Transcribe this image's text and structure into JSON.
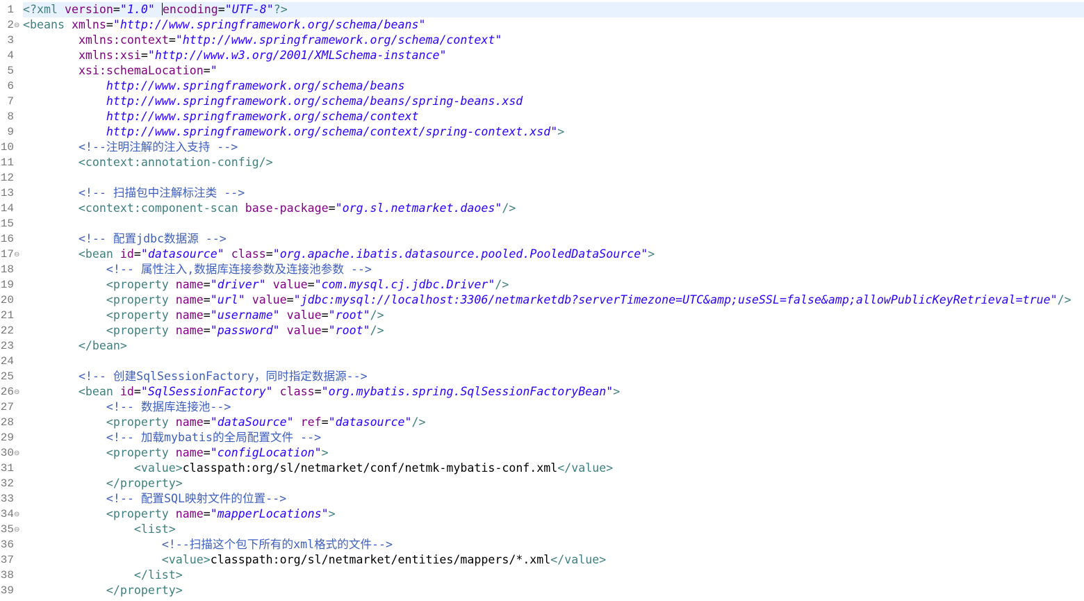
{
  "editor": {
    "file_type": "xml",
    "current_line": 1,
    "cursor": {
      "line": 1,
      "segment": 4,
      "offset": 1
    },
    "colors": {
      "tag": "#3f7f7f",
      "attr": "#7f007f",
      "value": "#2a00ff",
      "comment": "#3f5fbf",
      "text": "#000000",
      "line_number": "#787878",
      "current_line_bg": "#e8f2fe"
    },
    "lines": [
      {
        "num": "1",
        "fold": false,
        "segs": [
          {
            "t": "<?xml ",
            "k": "tag"
          },
          {
            "t": "version",
            "k": "attr"
          },
          {
            "t": "=",
            "k": "text"
          },
          {
            "t": "\"1.0\"",
            "k": "value"
          },
          {
            "t": " encoding",
            "k": "attr"
          },
          {
            "t": "=",
            "k": "text"
          },
          {
            "t": "\"UTF-8\"",
            "k": "value"
          },
          {
            "t": "?>",
            "k": "tag"
          }
        ]
      },
      {
        "num": "2",
        "fold": true,
        "segs": [
          {
            "t": "<beans ",
            "k": "tag"
          },
          {
            "t": "xmlns",
            "k": "attr"
          },
          {
            "t": "=",
            "k": "text"
          },
          {
            "t": "\"http://www.springframework.org/schema/beans\"",
            "k": "value"
          }
        ]
      },
      {
        "num": "3",
        "fold": false,
        "segs": [
          {
            "t": "        ",
            "k": "text"
          },
          {
            "t": "xmlns:context",
            "k": "attr"
          },
          {
            "t": "=",
            "k": "text"
          },
          {
            "t": "\"http://www.springframework.org/schema/context\"",
            "k": "value"
          }
        ]
      },
      {
        "num": "4",
        "fold": false,
        "segs": [
          {
            "t": "        ",
            "k": "text"
          },
          {
            "t": "xmlns:xsi",
            "k": "attr"
          },
          {
            "t": "=",
            "k": "text"
          },
          {
            "t": "\"http://www.w3.org/2001/XMLSchema-instance\"",
            "k": "value"
          }
        ]
      },
      {
        "num": "5",
        "fold": false,
        "segs": [
          {
            "t": "        ",
            "k": "text"
          },
          {
            "t": "xsi:schemaLocation",
            "k": "attr"
          },
          {
            "t": "=",
            "k": "text"
          },
          {
            "t": "\"",
            "k": "value"
          }
        ]
      },
      {
        "num": "6",
        "fold": false,
        "segs": [
          {
            "t": "            http://www.springframework.org/schema/beans",
            "k": "value"
          }
        ]
      },
      {
        "num": "7",
        "fold": false,
        "segs": [
          {
            "t": "            http://www.springframework.org/schema/beans/spring-beans.xsd",
            "k": "value"
          }
        ]
      },
      {
        "num": "8",
        "fold": false,
        "segs": [
          {
            "t": "            http://www.springframework.org/schema/context",
            "k": "value"
          }
        ]
      },
      {
        "num": "9",
        "fold": false,
        "segs": [
          {
            "t": "            http://www.springframework.org/schema/context/spring-context.xsd\"",
            "k": "value"
          },
          {
            "t": ">",
            "k": "tag"
          }
        ]
      },
      {
        "num": "10",
        "fold": false,
        "segs": [
          {
            "t": "        ",
            "k": "text"
          },
          {
            "t": "<!--注明注解的注入支持 -->",
            "k": "comment"
          }
        ]
      },
      {
        "num": "11",
        "fold": false,
        "segs": [
          {
            "t": "        <context:annotation-config/>",
            "k": "tag"
          }
        ]
      },
      {
        "num": "12",
        "fold": false,
        "segs": [
          {
            "t": "",
            "k": "text"
          }
        ]
      },
      {
        "num": "13",
        "fold": false,
        "segs": [
          {
            "t": "        ",
            "k": "text"
          },
          {
            "t": "<!-- 扫描包中注解标注类 -->",
            "k": "comment"
          }
        ]
      },
      {
        "num": "14",
        "fold": false,
        "segs": [
          {
            "t": "        <context:component-scan ",
            "k": "tag"
          },
          {
            "t": "base-package",
            "k": "attr"
          },
          {
            "t": "=",
            "k": "text"
          },
          {
            "t": "\"org.sl.netmarket.daoes\"",
            "k": "value"
          },
          {
            "t": "/>",
            "k": "tag"
          }
        ]
      },
      {
        "num": "15",
        "fold": false,
        "segs": [
          {
            "t": "",
            "k": "text"
          }
        ]
      },
      {
        "num": "16",
        "fold": false,
        "segs": [
          {
            "t": "        ",
            "k": "text"
          },
          {
            "t": "<!-- 配置jdbc数据源 -->",
            "k": "comment"
          }
        ]
      },
      {
        "num": "17",
        "fold": true,
        "segs": [
          {
            "t": "        <bean ",
            "k": "tag"
          },
          {
            "t": "id",
            "k": "attr"
          },
          {
            "t": "=",
            "k": "text"
          },
          {
            "t": "\"datasource\"",
            "k": "value"
          },
          {
            "t": " class",
            "k": "attr"
          },
          {
            "t": "=",
            "k": "text"
          },
          {
            "t": "\"org.apache.ibatis.datasource.pooled.PooledDataSource\"",
            "k": "value"
          },
          {
            "t": ">",
            "k": "tag"
          }
        ]
      },
      {
        "num": "18",
        "fold": false,
        "segs": [
          {
            "t": "            ",
            "k": "text"
          },
          {
            "t": "<!-- 属性注入,数据库连接参数及连接池参数 -->",
            "k": "comment"
          }
        ]
      },
      {
        "num": "19",
        "fold": false,
        "segs": [
          {
            "t": "            <property ",
            "k": "tag"
          },
          {
            "t": "name",
            "k": "attr"
          },
          {
            "t": "=",
            "k": "text"
          },
          {
            "t": "\"driver\"",
            "k": "value"
          },
          {
            "t": " value",
            "k": "attr"
          },
          {
            "t": "=",
            "k": "text"
          },
          {
            "t": "\"com.mysql.cj.jdbc.Driver\"",
            "k": "value"
          },
          {
            "t": "/>",
            "k": "tag"
          }
        ]
      },
      {
        "num": "20",
        "fold": false,
        "segs": [
          {
            "t": "            <property ",
            "k": "tag"
          },
          {
            "t": "name",
            "k": "attr"
          },
          {
            "t": "=",
            "k": "text"
          },
          {
            "t": "\"url\"",
            "k": "value"
          },
          {
            "t": " value",
            "k": "attr"
          },
          {
            "t": "=",
            "k": "text"
          },
          {
            "t": "\"jdbc:mysql://localhost:3306/netmarketdb?serverTimezone=UTC&amp;useSSL=false&amp;allowPublicKeyRetrieval=true\"",
            "k": "value"
          },
          {
            "t": "/>",
            "k": "tag"
          }
        ]
      },
      {
        "num": "21",
        "fold": false,
        "segs": [
          {
            "t": "            <property ",
            "k": "tag"
          },
          {
            "t": "name",
            "k": "attr"
          },
          {
            "t": "=",
            "k": "text"
          },
          {
            "t": "\"username\"",
            "k": "value"
          },
          {
            "t": " value",
            "k": "attr"
          },
          {
            "t": "=",
            "k": "text"
          },
          {
            "t": "\"root\"",
            "k": "value"
          },
          {
            "t": "/>",
            "k": "tag"
          }
        ]
      },
      {
        "num": "22",
        "fold": false,
        "segs": [
          {
            "t": "            <property ",
            "k": "tag"
          },
          {
            "t": "name",
            "k": "attr"
          },
          {
            "t": "=",
            "k": "text"
          },
          {
            "t": "\"password\"",
            "k": "value"
          },
          {
            "t": " value",
            "k": "attr"
          },
          {
            "t": "=",
            "k": "text"
          },
          {
            "t": "\"root\"",
            "k": "value"
          },
          {
            "t": "/>",
            "k": "tag"
          }
        ]
      },
      {
        "num": "23",
        "fold": false,
        "segs": [
          {
            "t": "        </bean>",
            "k": "tag"
          }
        ]
      },
      {
        "num": "24",
        "fold": false,
        "segs": [
          {
            "t": "",
            "k": "text"
          }
        ]
      },
      {
        "num": "25",
        "fold": false,
        "segs": [
          {
            "t": "        ",
            "k": "text"
          },
          {
            "t": "<!-- 创建SqlSessionFactory，同时指定数据源-->",
            "k": "comment"
          }
        ]
      },
      {
        "num": "26",
        "fold": true,
        "segs": [
          {
            "t": "        <bean ",
            "k": "tag"
          },
          {
            "t": "id",
            "k": "attr"
          },
          {
            "t": "=",
            "k": "text"
          },
          {
            "t": "\"SqlSessionFactory\"",
            "k": "value"
          },
          {
            "t": " class",
            "k": "attr"
          },
          {
            "t": "=",
            "k": "text"
          },
          {
            "t": "\"org.mybatis.spring.SqlSessionFactoryBean\"",
            "k": "value"
          },
          {
            "t": ">",
            "k": "tag"
          }
        ]
      },
      {
        "num": "27",
        "fold": false,
        "segs": [
          {
            "t": "            ",
            "k": "text"
          },
          {
            "t": "<!-- 数据库连接池-->",
            "k": "comment"
          }
        ]
      },
      {
        "num": "28",
        "fold": false,
        "segs": [
          {
            "t": "            <property ",
            "k": "tag"
          },
          {
            "t": "name",
            "k": "attr"
          },
          {
            "t": "=",
            "k": "text"
          },
          {
            "t": "\"dataSource\"",
            "k": "value"
          },
          {
            "t": " ref",
            "k": "attr"
          },
          {
            "t": "=",
            "k": "text"
          },
          {
            "t": "\"datasource\"",
            "k": "value"
          },
          {
            "t": "/>",
            "k": "tag"
          }
        ]
      },
      {
        "num": "29",
        "fold": false,
        "segs": [
          {
            "t": "            ",
            "k": "text"
          },
          {
            "t": "<!-- 加载mybatis的全局配置文件 -->",
            "k": "comment"
          }
        ]
      },
      {
        "num": "30",
        "fold": true,
        "segs": [
          {
            "t": "            <property ",
            "k": "tag"
          },
          {
            "t": "name",
            "k": "attr"
          },
          {
            "t": "=",
            "k": "text"
          },
          {
            "t": "\"configLocation\"",
            "k": "value"
          },
          {
            "t": ">",
            "k": "tag"
          }
        ]
      },
      {
        "num": "31",
        "fold": false,
        "segs": [
          {
            "t": "                <value>",
            "k": "tag"
          },
          {
            "t": "classpath:org/sl/netmarket/conf/netmk-mybatis-conf.xml",
            "k": "text"
          },
          {
            "t": "</value>",
            "k": "tag"
          }
        ]
      },
      {
        "num": "32",
        "fold": false,
        "segs": [
          {
            "t": "            </property>",
            "k": "tag"
          }
        ]
      },
      {
        "num": "33",
        "fold": false,
        "segs": [
          {
            "t": "            ",
            "k": "text"
          },
          {
            "t": "<!-- 配置SQL映射文件的位置-->",
            "k": "comment"
          }
        ]
      },
      {
        "num": "34",
        "fold": true,
        "segs": [
          {
            "t": "            <property ",
            "k": "tag"
          },
          {
            "t": "name",
            "k": "attr"
          },
          {
            "t": "=",
            "k": "text"
          },
          {
            "t": "\"mapperLocations\"",
            "k": "value"
          },
          {
            "t": ">",
            "k": "tag"
          }
        ]
      },
      {
        "num": "35",
        "fold": true,
        "segs": [
          {
            "t": "                <list>",
            "k": "tag"
          }
        ]
      },
      {
        "num": "36",
        "fold": false,
        "segs": [
          {
            "t": "                    ",
            "k": "text"
          },
          {
            "t": "<!--扫描这个包下所有的xml格式的文件-->",
            "k": "comment"
          }
        ]
      },
      {
        "num": "37",
        "fold": false,
        "segs": [
          {
            "t": "                    <value>",
            "k": "tag"
          },
          {
            "t": "classpath:org/sl/netmarket/entities/mappers/*.xml",
            "k": "text"
          },
          {
            "t": "</value>",
            "k": "tag"
          }
        ]
      },
      {
        "num": "38",
        "fold": false,
        "segs": [
          {
            "t": "                </list>",
            "k": "tag"
          }
        ]
      },
      {
        "num": "39",
        "fold": false,
        "segs": [
          {
            "t": "            </property>",
            "k": "tag"
          }
        ]
      }
    ]
  }
}
